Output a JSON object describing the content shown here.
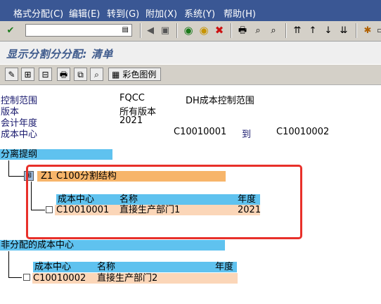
{
  "menu": [
    "格式分配(C)",
    "编辑(E)",
    "转到(G)",
    "附加(X)",
    "系统(Y)",
    "帮助(H)"
  ],
  "title": "显示分割分分配: 清单",
  "toolbar": {
    "color_legend_label": "彩色图例"
  },
  "header": {
    "controlling_area_label": "控制范围",
    "controlling_area_code": "FQCC",
    "controlling_area_name": "DH成本控制范围",
    "version_label": "版本",
    "version_value": "所有版本",
    "fiscal_year_label": "会计年度",
    "fiscal_year_value": "2021",
    "cost_center_label": "成本中心",
    "cost_center_from": "C10010001",
    "cost_center_to_label": "到",
    "cost_center_to": "C10010002"
  },
  "split_section": {
    "title": "分离提纲",
    "structure_code": "Z1",
    "structure_name": "C100分割结构",
    "columns": [
      "成本中心",
      "名称",
      "年度"
    ],
    "rows": [
      {
        "cost_center": "C10010001",
        "name": "直接生产部门1",
        "year": "2021"
      }
    ]
  },
  "unassigned_section": {
    "title": "非分配的成本中心",
    "columns": [
      "成本中心",
      "名称",
      "年度"
    ],
    "rows": [
      {
        "cost_center": "C10010002",
        "name": "直接生产部门2",
        "year": ""
      }
    ]
  },
  "colors": {
    "header_blue": "#5fc2ef",
    "row_peach": "#fbd6b8",
    "structure_orange": "#f7b56a",
    "highlight_red": "#e8302a"
  }
}
